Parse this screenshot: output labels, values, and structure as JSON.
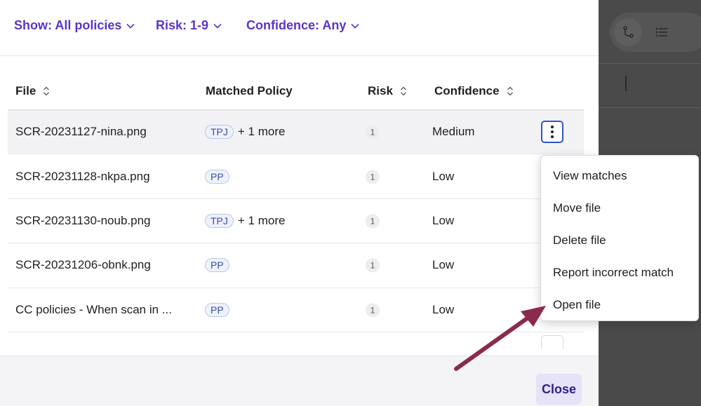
{
  "filters": {
    "show": "Show: All policies",
    "risk": "Risk: 1-9",
    "confidence": "Confidence: Any"
  },
  "table": {
    "headers": {
      "file": "File",
      "policy": "Matched Policy",
      "risk": "Risk",
      "confidence": "Confidence"
    },
    "rows": [
      {
        "file": "SCR-20231127-nina.png",
        "tag": "TPJ",
        "more": "+ 1 more",
        "risk": "1",
        "confidence": "Medium"
      },
      {
        "file": "SCR-20231128-nkpa.png",
        "tag": "PP",
        "more": "",
        "risk": "1",
        "confidence": "Low"
      },
      {
        "file": "SCR-20231130-noub.png",
        "tag": "TPJ",
        "more": "+ 1 more",
        "risk": "1",
        "confidence": "Low"
      },
      {
        "file": "SCR-20231206-obnk.png",
        "tag": "PP",
        "more": "",
        "risk": "1",
        "confidence": "Low"
      },
      {
        "file": "CC policies - When scan in ...",
        "tag": "PP",
        "more": "",
        "risk": "1",
        "confidence": "Low"
      }
    ]
  },
  "menu": {
    "items": [
      "View matches",
      "Move file",
      "Delete file",
      "Report incorrect match",
      "Open file"
    ]
  },
  "footer": {
    "close_label": "Close"
  },
  "colors": {
    "accent": "#5b34c9",
    "arrow": "#8a2a4e",
    "focus": "#2f55c9"
  },
  "icons": {
    "chevron": "chevron-down-icon",
    "sort": "sort-icon",
    "kebab": "kebab-menu-icon",
    "branch": "branch-icon",
    "list": "list-icon"
  }
}
